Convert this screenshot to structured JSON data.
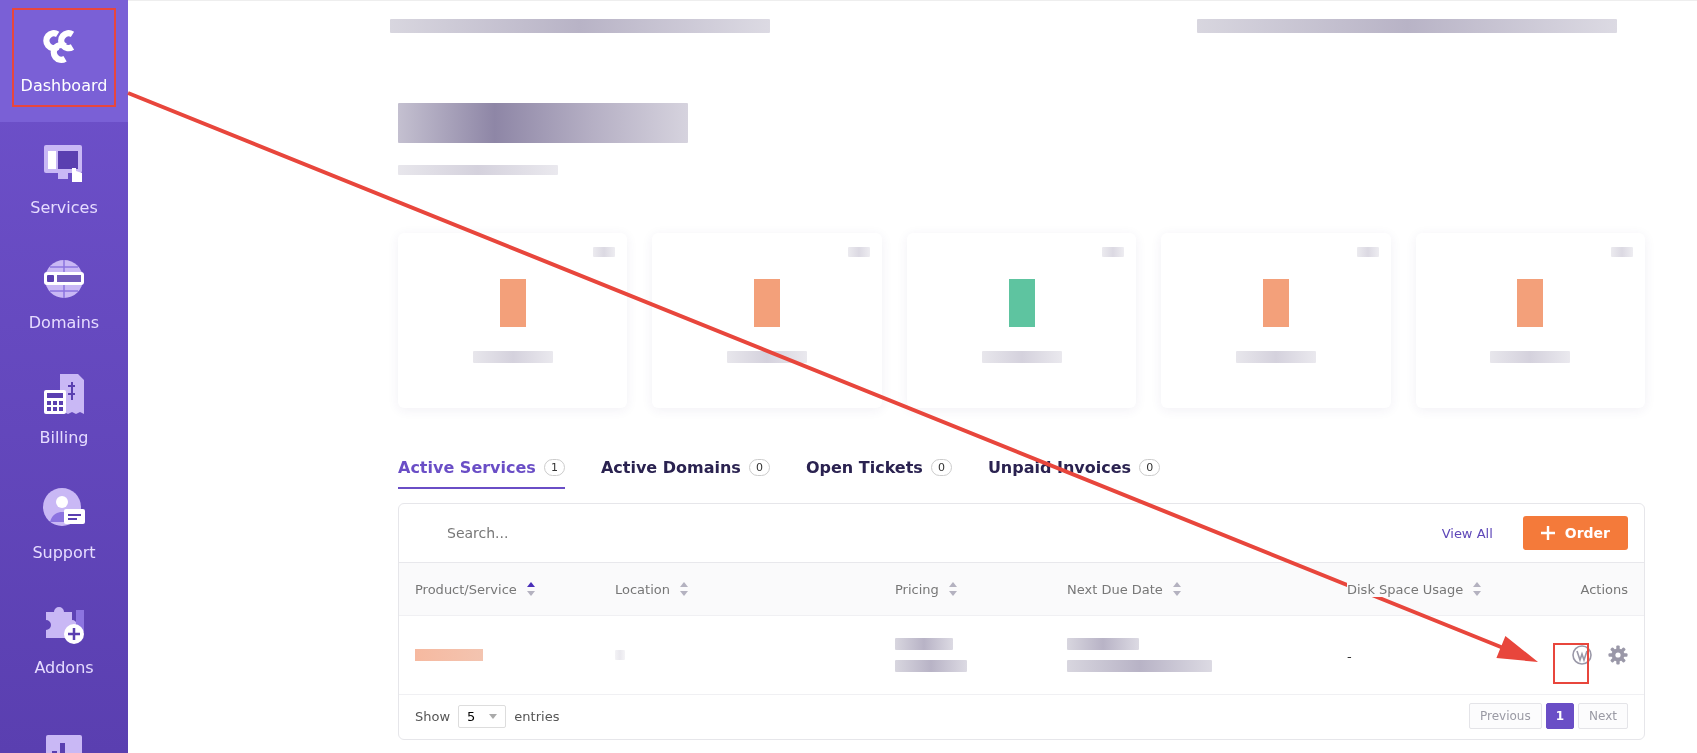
{
  "sidebar": {
    "items": [
      {
        "label": "Dashboard",
        "selected": true
      },
      {
        "label": "Services",
        "selected": false
      },
      {
        "label": "Domains",
        "selected": false
      },
      {
        "label": "Billing",
        "selected": false
      },
      {
        "label": "Support",
        "selected": false
      },
      {
        "label": "Addons",
        "selected": false
      },
      {
        "selected": false
      }
    ]
  },
  "stat_cards": [
    {
      "color": "#f3a07a"
    },
    {
      "color": "#f3a07a"
    },
    {
      "color": "#5ec4a0"
    },
    {
      "color": "#f3a07a"
    },
    {
      "color": "#f3a07a"
    }
  ],
  "tabs": [
    {
      "label": "Active Services",
      "count": "1",
      "selected": true
    },
    {
      "label": "Active Domains",
      "count": "0",
      "selected": false
    },
    {
      "label": "Open Tickets",
      "count": "0",
      "selected": false
    },
    {
      "label": "Unpaid Invoices",
      "count": "0",
      "selected": false
    }
  ],
  "table": {
    "search": {
      "placeholder": "Search..."
    },
    "view_all": "View All",
    "order_button": "Order",
    "columns": [
      {
        "label": "Product/Service",
        "sortable": true,
        "sorted": true
      },
      {
        "label": "Location",
        "sortable": true,
        "sorted": false
      },
      {
        "label": "Pricing",
        "sortable": true,
        "sorted": false
      },
      {
        "label": "Next Due Date",
        "sortable": true,
        "sorted": false
      },
      {
        "label": "Disk Space Usage",
        "sortable": true,
        "sorted": false
      },
      {
        "label": "Actions"
      }
    ],
    "rows": [
      {
        "disk_space_usage": "-"
      }
    ],
    "show_label": "Show",
    "page_size": "5",
    "entries_label": "entries",
    "pagination": [
      {
        "label": "Previous",
        "kind": "nav",
        "disabled": true,
        "selected": false
      },
      {
        "label": "1",
        "kind": "page",
        "disabled": false,
        "selected": true
      },
      {
        "label": "Next",
        "kind": "nav",
        "disabled": true,
        "selected": false
      }
    ]
  }
}
